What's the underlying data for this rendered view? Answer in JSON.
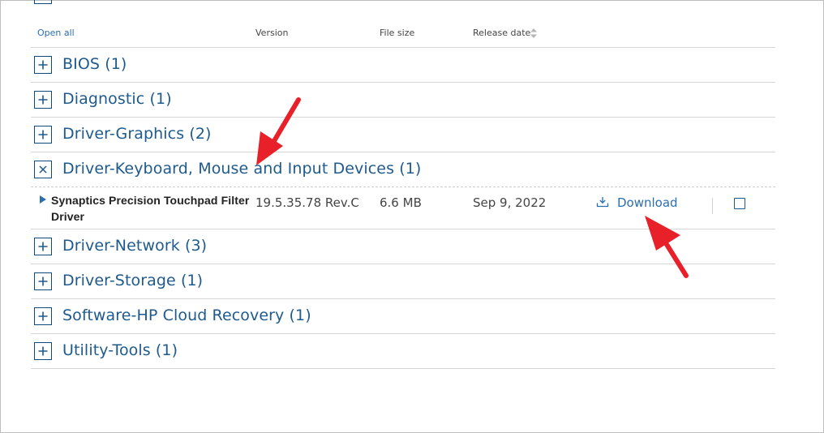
{
  "table": {
    "open_all": "Open all",
    "columns": {
      "version": "Version",
      "file_size": "File size",
      "release_date": "Release date"
    }
  },
  "categories": [
    {
      "label": "BIOS (1)",
      "expanded": false
    },
    {
      "label": "Diagnostic (1)",
      "expanded": false
    },
    {
      "label": "Driver-Graphics (2)",
      "expanded": false
    },
    {
      "label": "Driver-Keyboard, Mouse and Input Devices (1)",
      "expanded": true
    },
    {
      "label": "Driver-Network (3)",
      "expanded": false
    },
    {
      "label": "Driver-Storage (1)",
      "expanded": false
    },
    {
      "label": "Software-HP Cloud Recovery (1)",
      "expanded": false
    },
    {
      "label": "Utility-Tools (1)",
      "expanded": false
    }
  ],
  "driver": {
    "name": "Synaptics Precision Touchpad Filter Driver",
    "version": "19.5.35.78 Rev.C",
    "file_size": "6.6 MB",
    "release_date": "Sep 9, 2022",
    "download_label": "Download"
  },
  "colors": {
    "link": "#2a6eb0",
    "category_text": "#1e5a8e",
    "box_border": "#0e4a7a",
    "annotation_arrow": "#e8202a"
  },
  "icons": {
    "expand": "plus-icon",
    "collapse": "close-icon",
    "sort": "sort-icon",
    "download": "download-icon",
    "row_toggle": "triangle-right-icon"
  }
}
